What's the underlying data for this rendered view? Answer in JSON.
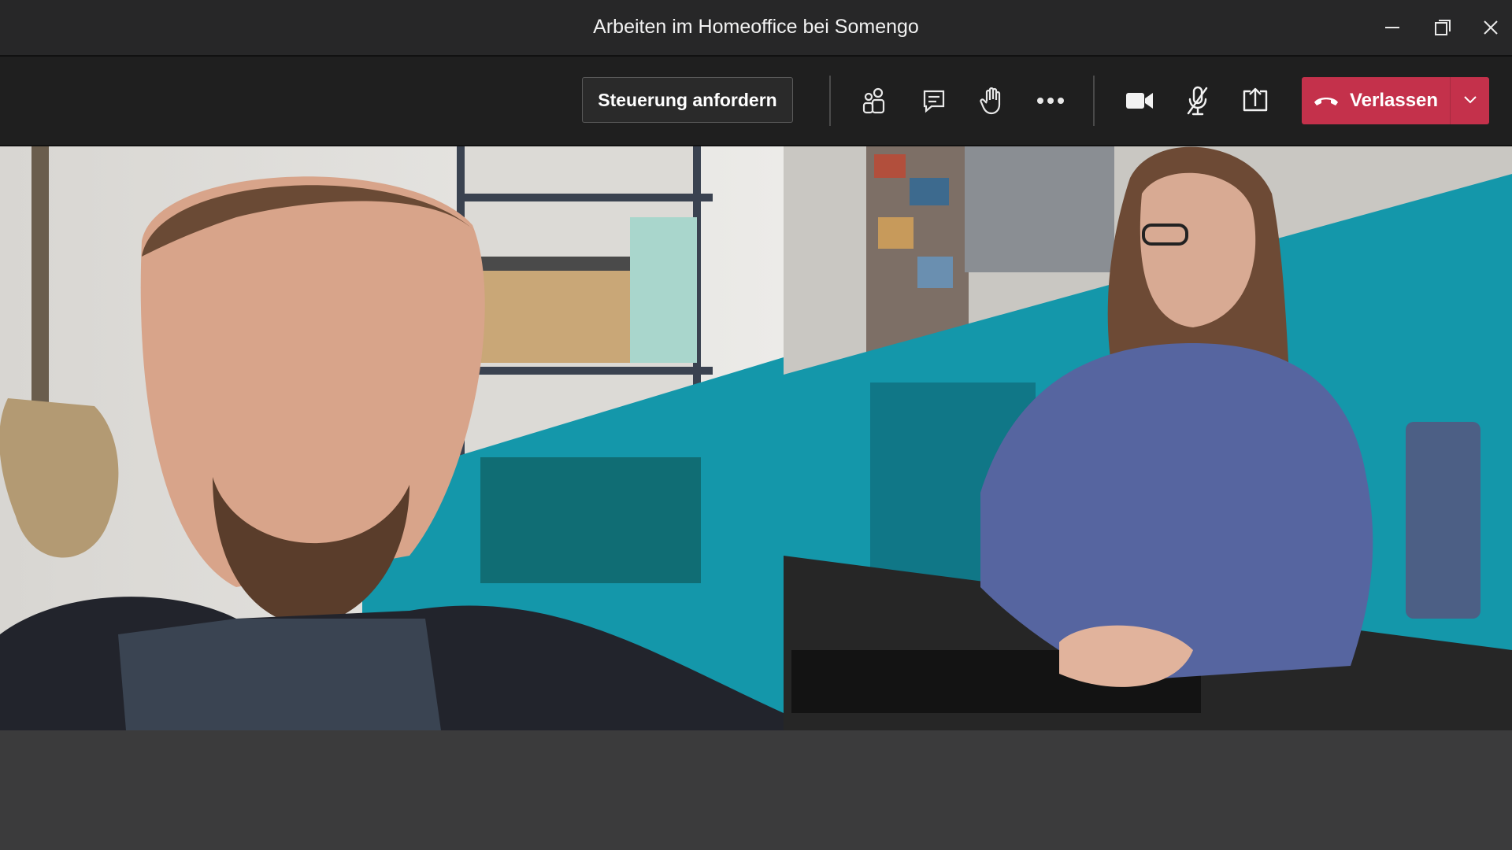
{
  "window": {
    "title": "Arbeiten im Homeoffice bei Somengo",
    "controls": [
      "minimize-icon",
      "restore-icon",
      "close-icon"
    ]
  },
  "toolbar": {
    "request_control_label": "Steuerung anfordern",
    "icons": [
      "participants-icon",
      "chat-icon",
      "raise-hand-icon",
      "more-options-icon",
      "camera-icon",
      "mic-off-icon",
      "share-screen-icon"
    ],
    "leave_label": "Verlassen",
    "leave_icon": "hang-up-icon",
    "leave_dropdown_icon": "chevron-down-icon"
  },
  "colors": {
    "accent_leave": "#c4314b",
    "background_teal": "#1497aa",
    "titlebar": "#272728",
    "toolbar": "#1f1f1f",
    "stage_bottom": "#3b3b3c"
  },
  "videos": [
    {
      "participant": "participant-1",
      "background_effect": "teal diagonal band"
    },
    {
      "participant": "participant-2",
      "background_effect": "teal diagonal band"
    }
  ]
}
